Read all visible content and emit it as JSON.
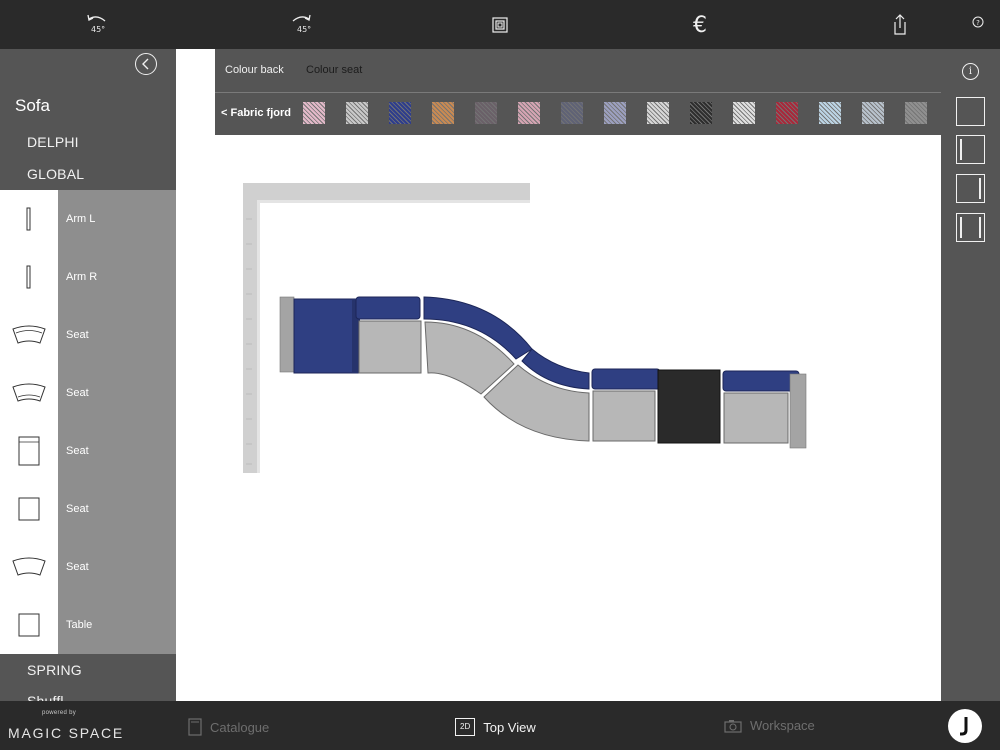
{
  "toolbar": {
    "rotate_left_label": "45°",
    "rotate_right_label": "45°",
    "currency_symbol": "€"
  },
  "sidebar": {
    "title": "Sofa",
    "categories_top": [
      "DELPHI",
      "GLOBAL"
    ],
    "items": [
      {
        "label": "Arm L",
        "thumb": "arm-l-icon"
      },
      {
        "label": "Arm R",
        "thumb": "arm-r-icon"
      },
      {
        "label": "Seat",
        "thumb": "curved-seat-icon"
      },
      {
        "label": "Seat",
        "thumb": "curved-seat-icon"
      },
      {
        "label": "Seat",
        "thumb": "seat-back-icon"
      },
      {
        "label": "Seat",
        "thumb": "square-seat-icon"
      },
      {
        "label": "Seat",
        "thumb": "curved-seat-icon"
      },
      {
        "label": "Table",
        "thumb": "table-icon"
      }
    ],
    "categories_bottom": [
      "SPRING",
      "Shuffl"
    ]
  },
  "fabric_panel": {
    "tabs": [
      {
        "label": "Colour back",
        "active": false
      },
      {
        "label": "Colour seat",
        "active": true
      }
    ],
    "back_label": "< Fabric fjord",
    "swatches": [
      "#e3b9c9",
      "#c9c9c9",
      "#2e3d8c",
      "#c98a52",
      "#6a6068",
      "#d5a4b3",
      "#5f6275",
      "#9ca0c0",
      "#d7d7d7",
      "#2e2e2e",
      "#e0e0e0",
      "#a8283a",
      "#bcd4e4",
      "#b8c2cc",
      "#909090"
    ]
  },
  "bottombar": {
    "powered_by": "powered by",
    "brand": "MAGIC SPACE",
    "tabs": [
      {
        "label": "Catalogue",
        "icon": "catalogue-icon",
        "active": false
      },
      {
        "label": "Top View",
        "icon": "2d-icon",
        "icon_text": "2D",
        "active": true
      },
      {
        "label": "Workspace",
        "icon": "camera-icon",
        "active": false
      }
    ]
  },
  "colors": {
    "upholstery_blue": "#2f3f82",
    "seat_grey": "#b7b7b7",
    "table_black": "#2a2a2a"
  }
}
